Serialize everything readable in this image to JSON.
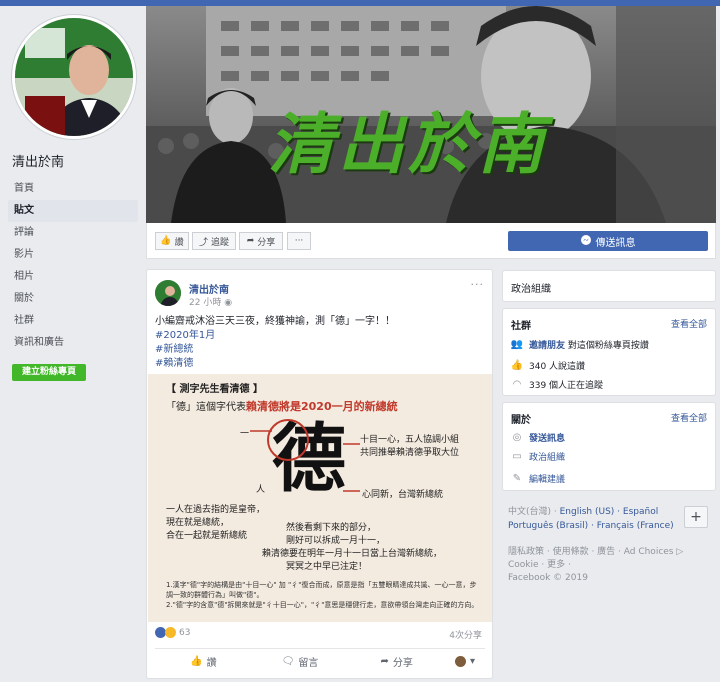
{
  "page": {
    "name": "清出於南",
    "create_page": "建立粉絲專頁"
  },
  "leftnav": [
    {
      "label": "首頁"
    },
    {
      "label": "貼文"
    },
    {
      "label": "評論"
    },
    {
      "label": "影片"
    },
    {
      "label": "相片"
    },
    {
      "label": "關於"
    },
    {
      "label": "社群"
    },
    {
      "label": "資訊和廣告"
    }
  ],
  "cover": {
    "title": "清出於南",
    "like": "讚",
    "follow": "追蹤",
    "share": "分享",
    "more": "···",
    "send_message": "傳送訊息"
  },
  "post": {
    "author": "清出於南",
    "time": "22 小時",
    "text": "小編齋戒沐浴三天三夜，終獲神諭，測「德」一字！！",
    "hashtags": [
      "#2020年1月",
      "#新總統",
      "#賴清德"
    ],
    "image": {
      "heading": "【 測字先生看清德 】",
      "line1_prefix": "「德」這個字代表",
      "line1_highlight": "賴清德將是2020一月的新總統",
      "big_char": "德",
      "label_one": "一",
      "label_person": "人",
      "right_note1": "十目一心，五人協調小組",
      "right_note2": "共同推舉賴清德爭取大位",
      "heart_note": "心同新，台灣新總統",
      "left_note": "一人在過去指的是皇帝，\n現在就是總統，\n合在一起就是新總統",
      "bottom_note1": "然後看剩下來的部分，",
      "bottom_note2": "剛好可以拆成一月十一，",
      "bottom_note3": "賴清德要在明年一月十一日當上台灣新總統，",
      "bottom_note4": "冥冥之中早已注定！",
      "fine1": "1.漢字\"德\"字的結構是由\"十目一心\" 加 \"彳\"復合而成，原意是指「五雙眼睛達成共識、一心一意，步調一致的群體行為」叫做\"德\"。",
      "fine2": "2.\"德\"字的含意\"德\"拆開來就是\"彳十目一心\"，\"彳\"意思是穩健行走，意欲帶領台灣走向正確的方向。"
    },
    "reaction_count": "63",
    "shares": "4次分享",
    "actions": {
      "like": "讚",
      "comment": "留言",
      "share": "分享"
    }
  },
  "right": {
    "category": "政治組織",
    "community": {
      "title": "社群",
      "see_all": "查看全部",
      "invite_link": "邀請朋友",
      "invite_rest": "對這個粉絲專頁按讚",
      "likes": "340 人說這讚",
      "follows": "339 個人正在追蹤"
    },
    "about": {
      "title": "關於",
      "see_all": "查看全部",
      "send_message": "發送訊息",
      "category": "政治組織",
      "suggest_edit": "編輯建議"
    },
    "languages": {
      "current": "中文(台灣)",
      "others": "English (US) · Español",
      "others2": "Português (Brasil) · Français (France)",
      "plus": "+"
    },
    "footer": {
      "line1": "隱私政策 · 使用條款 · 廣告 · Ad Choices ▷",
      "line2": "Cookie · 更多 ·",
      "line3": "Facebook © 2019"
    }
  },
  "colors": {
    "brand": "#4267b2",
    "link": "#365899",
    "green": "#42b72a",
    "highlight_red": "#c0392b"
  }
}
